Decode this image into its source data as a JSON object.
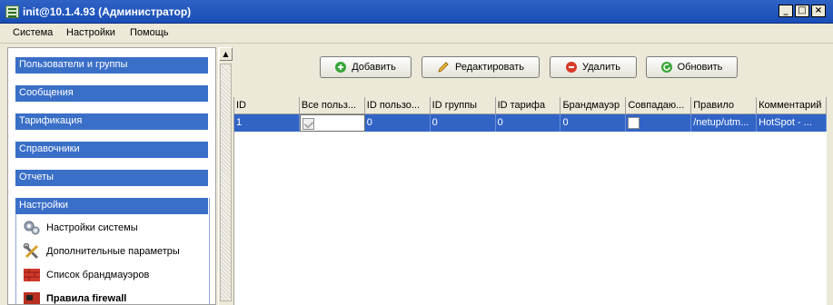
{
  "window": {
    "title": "init@10.1.4.93 (Администратор)",
    "controls": [
      "_",
      "□",
      "×"
    ]
  },
  "menu": [
    "Система",
    "Настройки",
    "Помощь"
  ],
  "sidebar": {
    "sections": [
      "Пользователи и группы",
      "Сообщения",
      "Тарификация",
      "Справочники",
      "Отчеты",
      "Настройки"
    ],
    "settings_items": [
      {
        "label": "Настройки системы",
        "icon": "gears-icon"
      },
      {
        "label": "Дополнительные параметры",
        "icon": "tools-icon"
      },
      {
        "label": "Список брандмауэров",
        "icon": "firewall-icon"
      },
      {
        "label": "Правила firewall",
        "icon": "rules-icon"
      }
    ]
  },
  "toolbar": {
    "add_label": "Добавить",
    "edit_label": "Редактировать",
    "delete_label": "Удалить",
    "refresh_label": "Обновить",
    "colors": {
      "add": "#3aa63a",
      "edit": "#e8b23a",
      "delete": "#d83a2a",
      "refresh": "#3aa63a"
    }
  },
  "table": {
    "columns": [
      "ID",
      "Все польз...",
      "ID пользо...",
      "ID группы",
      "ID тарифа",
      "Брандмауэр",
      "Совпадаю...",
      "Правило",
      "Комментарий"
    ],
    "rows": [
      {
        "id": "1",
        "all_users": true,
        "user_id": "0",
        "group_id": "0",
        "tariff_id": "0",
        "firewall": "0",
        "match": false,
        "rule": "/netup/utm...",
        "comment": "HotSpot - ..."
      }
    ],
    "selection_color": "#3264c6"
  }
}
